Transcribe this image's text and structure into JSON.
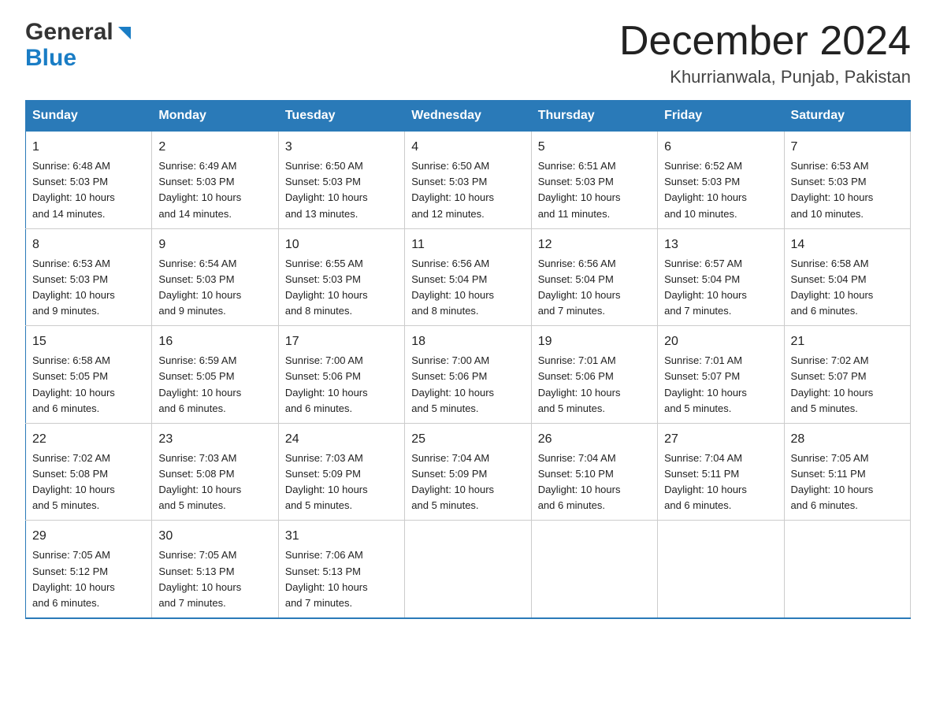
{
  "header": {
    "logo_general": "General",
    "logo_blue": "Blue",
    "month_year": "December 2024",
    "location": "Khurrianwala, Punjab, Pakistan"
  },
  "days_of_week": [
    "Sunday",
    "Monday",
    "Tuesday",
    "Wednesday",
    "Thursday",
    "Friday",
    "Saturday"
  ],
  "weeks": [
    [
      {
        "num": "1",
        "sunrise": "6:48 AM",
        "sunset": "5:03 PM",
        "daylight": "10 hours and 14 minutes."
      },
      {
        "num": "2",
        "sunrise": "6:49 AM",
        "sunset": "5:03 PM",
        "daylight": "10 hours and 14 minutes."
      },
      {
        "num": "3",
        "sunrise": "6:50 AM",
        "sunset": "5:03 PM",
        "daylight": "10 hours and 13 minutes."
      },
      {
        "num": "4",
        "sunrise": "6:50 AM",
        "sunset": "5:03 PM",
        "daylight": "10 hours and 12 minutes."
      },
      {
        "num": "5",
        "sunrise": "6:51 AM",
        "sunset": "5:03 PM",
        "daylight": "10 hours and 11 minutes."
      },
      {
        "num": "6",
        "sunrise": "6:52 AM",
        "sunset": "5:03 PM",
        "daylight": "10 hours and 10 minutes."
      },
      {
        "num": "7",
        "sunrise": "6:53 AM",
        "sunset": "5:03 PM",
        "daylight": "10 hours and 10 minutes."
      }
    ],
    [
      {
        "num": "8",
        "sunrise": "6:53 AM",
        "sunset": "5:03 PM",
        "daylight": "10 hours and 9 minutes."
      },
      {
        "num": "9",
        "sunrise": "6:54 AM",
        "sunset": "5:03 PM",
        "daylight": "10 hours and 9 minutes."
      },
      {
        "num": "10",
        "sunrise": "6:55 AM",
        "sunset": "5:03 PM",
        "daylight": "10 hours and 8 minutes."
      },
      {
        "num": "11",
        "sunrise": "6:56 AM",
        "sunset": "5:04 PM",
        "daylight": "10 hours and 8 minutes."
      },
      {
        "num": "12",
        "sunrise": "6:56 AM",
        "sunset": "5:04 PM",
        "daylight": "10 hours and 7 minutes."
      },
      {
        "num": "13",
        "sunrise": "6:57 AM",
        "sunset": "5:04 PM",
        "daylight": "10 hours and 7 minutes."
      },
      {
        "num": "14",
        "sunrise": "6:58 AM",
        "sunset": "5:04 PM",
        "daylight": "10 hours and 6 minutes."
      }
    ],
    [
      {
        "num": "15",
        "sunrise": "6:58 AM",
        "sunset": "5:05 PM",
        "daylight": "10 hours and 6 minutes."
      },
      {
        "num": "16",
        "sunrise": "6:59 AM",
        "sunset": "5:05 PM",
        "daylight": "10 hours and 6 minutes."
      },
      {
        "num": "17",
        "sunrise": "7:00 AM",
        "sunset": "5:06 PM",
        "daylight": "10 hours and 6 minutes."
      },
      {
        "num": "18",
        "sunrise": "7:00 AM",
        "sunset": "5:06 PM",
        "daylight": "10 hours and 5 minutes."
      },
      {
        "num": "19",
        "sunrise": "7:01 AM",
        "sunset": "5:06 PM",
        "daylight": "10 hours and 5 minutes."
      },
      {
        "num": "20",
        "sunrise": "7:01 AM",
        "sunset": "5:07 PM",
        "daylight": "10 hours and 5 minutes."
      },
      {
        "num": "21",
        "sunrise": "7:02 AM",
        "sunset": "5:07 PM",
        "daylight": "10 hours and 5 minutes."
      }
    ],
    [
      {
        "num": "22",
        "sunrise": "7:02 AM",
        "sunset": "5:08 PM",
        "daylight": "10 hours and 5 minutes."
      },
      {
        "num": "23",
        "sunrise": "7:03 AM",
        "sunset": "5:08 PM",
        "daylight": "10 hours and 5 minutes."
      },
      {
        "num": "24",
        "sunrise": "7:03 AM",
        "sunset": "5:09 PM",
        "daylight": "10 hours and 5 minutes."
      },
      {
        "num": "25",
        "sunrise": "7:04 AM",
        "sunset": "5:09 PM",
        "daylight": "10 hours and 5 minutes."
      },
      {
        "num": "26",
        "sunrise": "7:04 AM",
        "sunset": "5:10 PM",
        "daylight": "10 hours and 6 minutes."
      },
      {
        "num": "27",
        "sunrise": "7:04 AM",
        "sunset": "5:11 PM",
        "daylight": "10 hours and 6 minutes."
      },
      {
        "num": "28",
        "sunrise": "7:05 AM",
        "sunset": "5:11 PM",
        "daylight": "10 hours and 6 minutes."
      }
    ],
    [
      {
        "num": "29",
        "sunrise": "7:05 AM",
        "sunset": "5:12 PM",
        "daylight": "10 hours and 6 minutes."
      },
      {
        "num": "30",
        "sunrise": "7:05 AM",
        "sunset": "5:13 PM",
        "daylight": "10 hours and 7 minutes."
      },
      {
        "num": "31",
        "sunrise": "7:06 AM",
        "sunset": "5:13 PM",
        "daylight": "10 hours and 7 minutes."
      },
      null,
      null,
      null,
      null
    ]
  ],
  "sunrise_label": "Sunrise:",
  "sunset_label": "Sunset:",
  "daylight_label": "Daylight:"
}
